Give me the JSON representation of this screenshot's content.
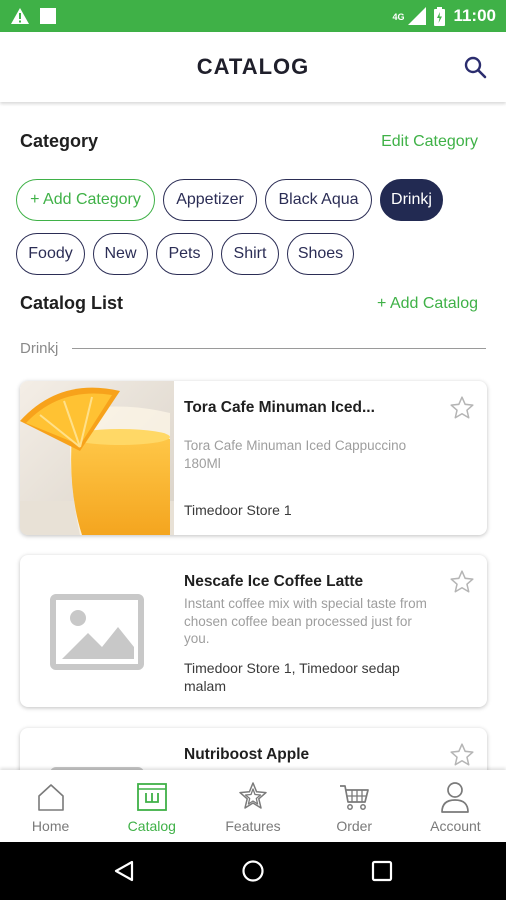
{
  "status_bar": {
    "network": "4G",
    "time": "11:00"
  },
  "app_bar": {
    "title": "CATALOG"
  },
  "category": {
    "title": "Category",
    "edit_label": "Edit Category",
    "add_chip": "+ Add Category",
    "chips": [
      "Appetizer",
      "Black Aqua",
      "Drinkj",
      "Foody",
      "New",
      "Pets",
      "Shirt",
      "Shoes"
    ],
    "selected": "Drinkj"
  },
  "catalog_list": {
    "title": "Catalog List",
    "add_label": "+ Add Catalog",
    "filter_label": "Drinkj",
    "items": [
      {
        "name": "Tora Cafe Minuman Iced...",
        "description": "Tora Cafe Minuman Iced Cappuccino 180Ml",
        "store": "Timedoor Store 1",
        "image": "orange-juice-photo",
        "favorite": false
      },
      {
        "name": "Nescafe Ice Coffee Latte",
        "description": "Instant coffee mix with special taste from chosen coffee bean processed just for you.",
        "store": "Timedoor Store 1, Timedoor sedap malam",
        "image": "image-placeholder-icon",
        "favorite": false
      },
      {
        "name": "Nutriboost Apple",
        "description": "",
        "store": "",
        "image": "image-placeholder-icon",
        "favorite": false
      }
    ]
  },
  "bottom_nav": {
    "items": [
      {
        "label": "Home",
        "icon": "home-icon"
      },
      {
        "label": "Catalog",
        "icon": "catalog-icon"
      },
      {
        "label": "Features",
        "icon": "features-icon"
      },
      {
        "label": "Order",
        "icon": "cart-icon"
      },
      {
        "label": "Account",
        "icon": "account-icon"
      }
    ],
    "active": "Catalog"
  },
  "colors": {
    "accent": "#3fb147",
    "navy": "#222a52",
    "muted": "#9e9e9e"
  }
}
